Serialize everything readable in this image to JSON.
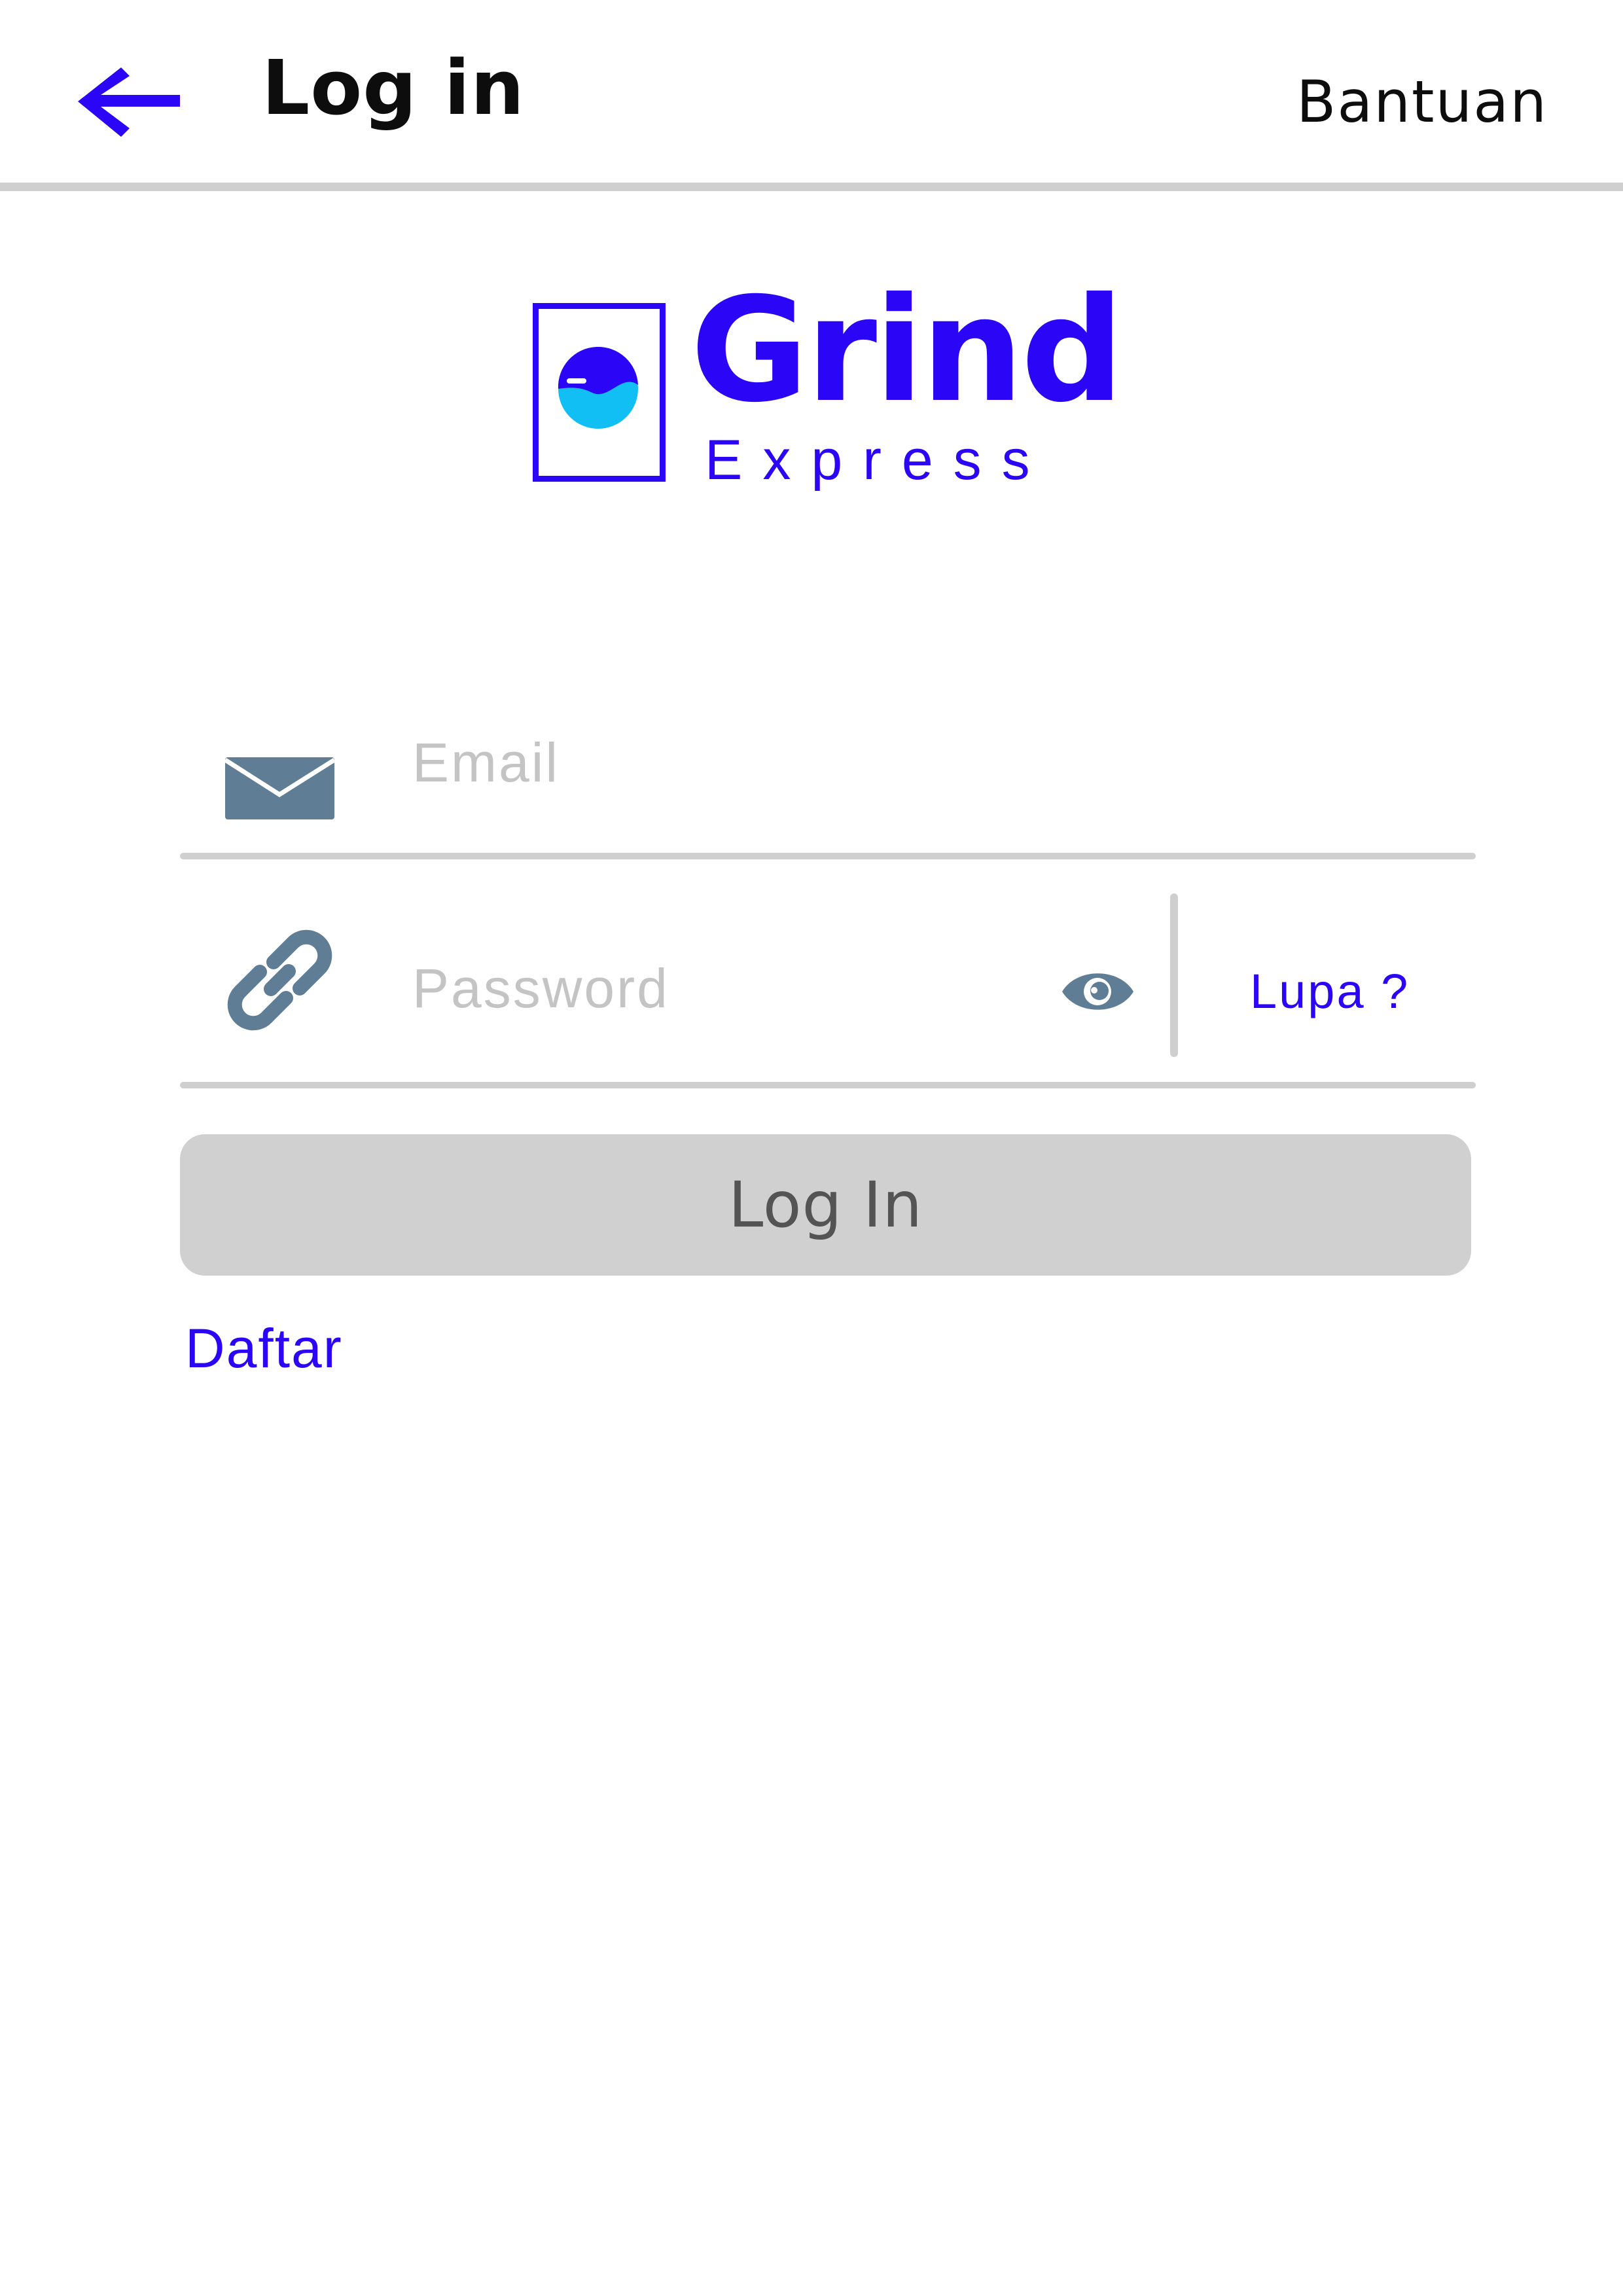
{
  "header": {
    "title": "Log in",
    "help_label": "Bantuan"
  },
  "logo": {
    "name": "Grind",
    "subtitle": "Express"
  },
  "form": {
    "email": {
      "icon": "envelope-icon",
      "placeholder": "Email",
      "value": ""
    },
    "password": {
      "icon": "link-icon",
      "placeholder": "Password",
      "value": "",
      "toggle_icon": "eye-icon",
      "forgot_label": "Lupa ?"
    },
    "submit_label": "Log In",
    "register_label": "Daftar"
  },
  "colors": {
    "accent": "#2b05f5",
    "logo_light": "#11bff5",
    "icon": "#607d96",
    "button_bg": "#d0d0d0",
    "divider": "#cfcfcf"
  }
}
